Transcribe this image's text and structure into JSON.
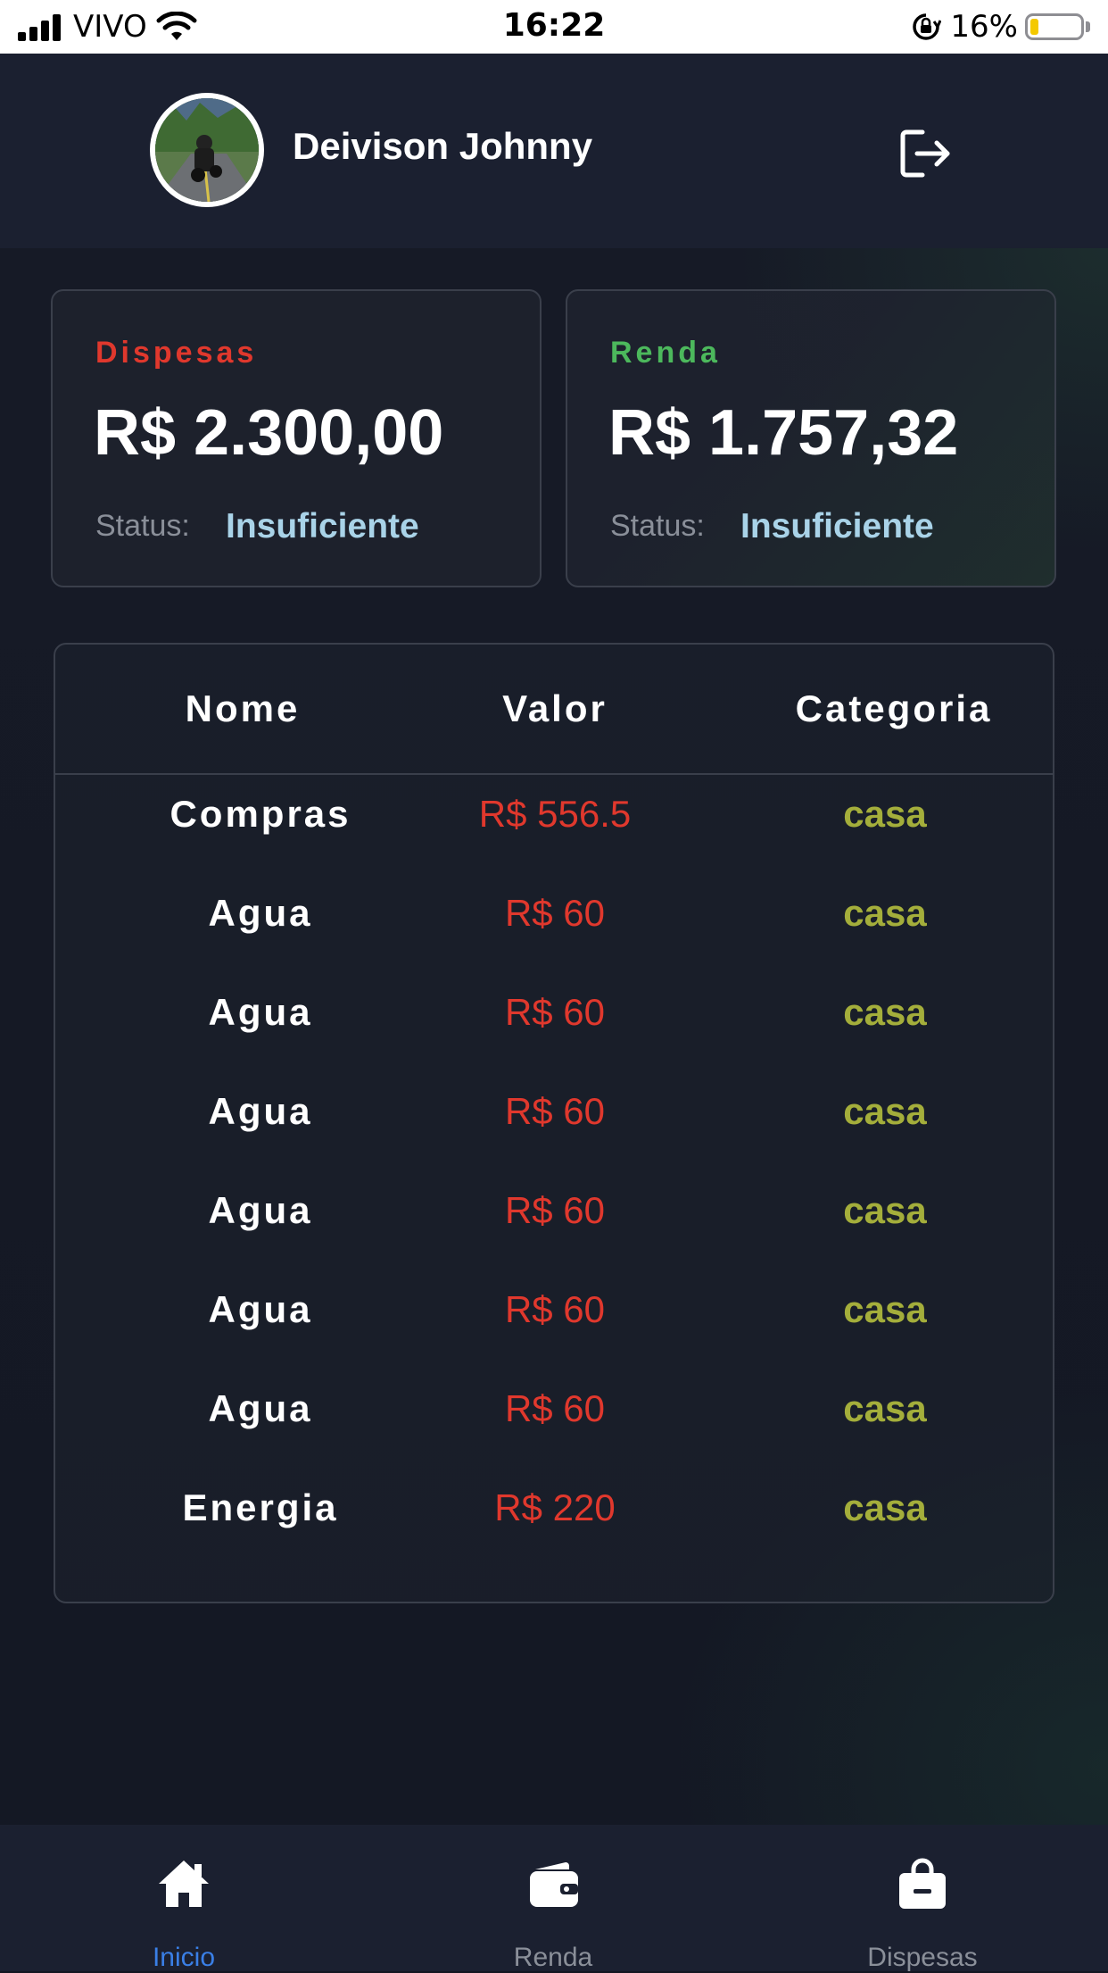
{
  "status_bar": {
    "carrier": "VIVO",
    "time": "16:22",
    "battery_percent": "16%",
    "battery_level": 0.16
  },
  "header": {
    "user_name": "Deivison Johnny",
    "logout_icon": "logout-icon"
  },
  "cards": {
    "dispesas": {
      "title": "Dispesas",
      "amount": "R$ 2.300,00",
      "status_label": "Status:",
      "status_value": "Insuficiente",
      "title_color": "#e0382d"
    },
    "renda": {
      "title": "Renda",
      "amount": "R$ 1.757,32",
      "status_label": "Status:",
      "status_value": "Insuficiente",
      "title_color": "#4cb85c"
    }
  },
  "table": {
    "headers": {
      "nome": "Nome",
      "valor": "Valor",
      "categoria": "Categoria"
    },
    "rows": [
      {
        "nome": "Compras",
        "valor": "R$ 556.5",
        "categoria": "casa"
      },
      {
        "nome": "Agua",
        "valor": "R$ 60",
        "categoria": "casa"
      },
      {
        "nome": "Agua",
        "valor": "R$ 60",
        "categoria": "casa"
      },
      {
        "nome": "Agua",
        "valor": "R$ 60",
        "categoria": "casa"
      },
      {
        "nome": "Agua",
        "valor": "R$ 60",
        "categoria": "casa"
      },
      {
        "nome": "Agua",
        "valor": "R$ 60",
        "categoria": "casa"
      },
      {
        "nome": "Agua",
        "valor": "R$ 60",
        "categoria": "casa"
      },
      {
        "nome": "Energia",
        "valor": "R$ 220",
        "categoria": "casa"
      }
    ]
  },
  "tabbar": {
    "tabs": [
      {
        "label": "Inicio",
        "icon": "home-icon",
        "active": true
      },
      {
        "label": "Renda",
        "icon": "wallet-icon",
        "active": false
      },
      {
        "label": "Dispesas",
        "icon": "shopping-bag-icon",
        "active": false
      }
    ],
    "active_color": "#3a7fe6"
  }
}
